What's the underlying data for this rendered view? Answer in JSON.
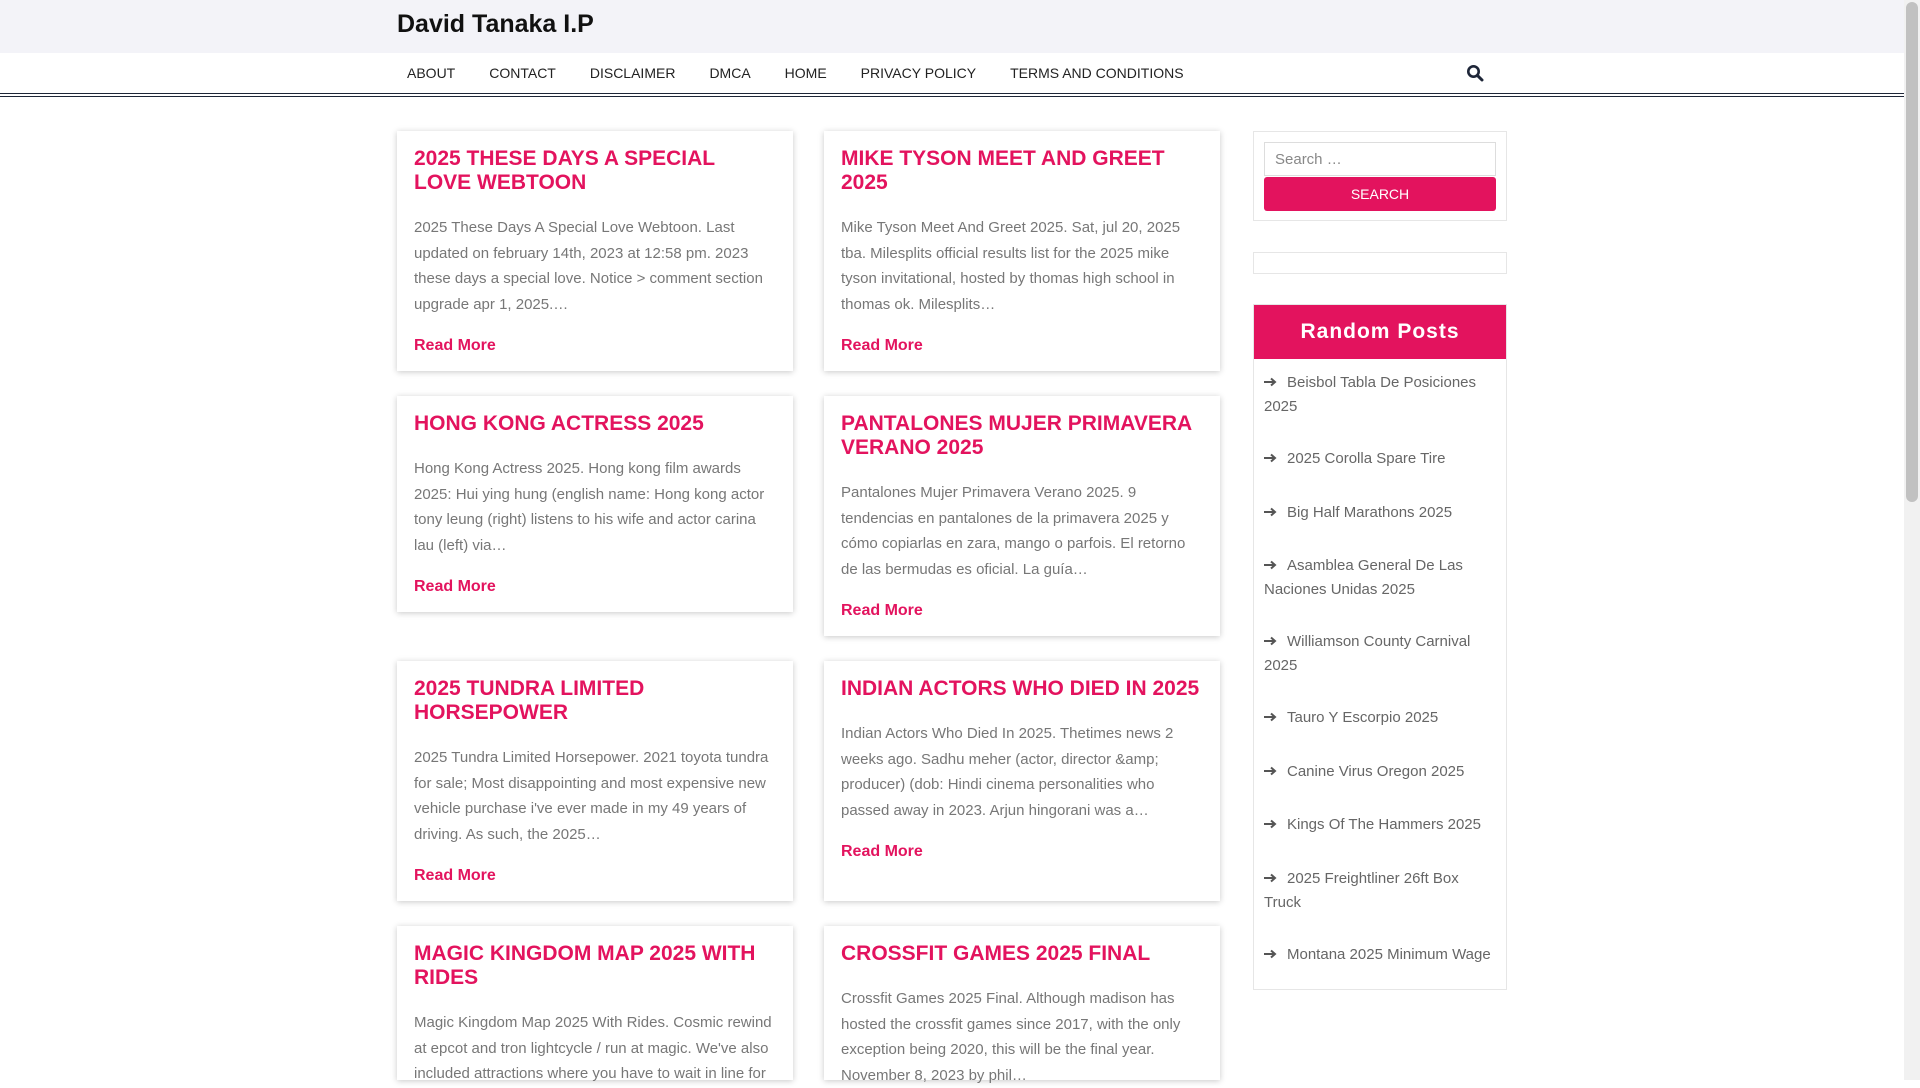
{
  "site": {
    "title": "David Tanaka I.P"
  },
  "nav": [
    "ABOUT",
    "CONTACT",
    "DISCLAIMER",
    "DMCA",
    "HOME",
    "PRIVACY POLICY",
    "TERMS AND CONDITIONS"
  ],
  "posts": [
    {
      "title": "2025 THESE DAYS A SPECIAL LOVE WEBTOON",
      "excerpt": "2025 These Days A Special Love Webtoon. Last updated on february 14th, 2023 at 12:58 pm. 2023 these days a special love. Notice > comment section upgrade apr 1, 2025.…",
      "more": "Read More"
    },
    {
      "title": "MIKE TYSON MEET AND GREET 2025",
      "excerpt": "Mike Tyson Meet And Greet 2025. Sat, jul 20, 2025 tba. Milesplits official results list for the 2025 mike tyson invitational, hosted by thomas high school in thomas ok. Milesplits…",
      "more": "Read More"
    },
    {
      "title": "HONG KONG ACTRESS 2025",
      "excerpt": "Hong Kong Actress 2025. Hong kong film awards 2025: Hui ying hung (english name: Hong kong actor tony leung (right) listens to his wife and actor carina lau (left) via…",
      "more": "Read More"
    },
    {
      "title": "PANTALONES MUJER PRIMAVERA VERANO 2025",
      "excerpt": "Pantalones Mujer Primavera Verano 2025. 9 tendencias en pantalones de la primavera 2025 y cómo copiarlas en zara, mango o parfois. El retorno de las bermudas es oficial. La guía…",
      "more": "Read More"
    },
    {
      "title": "2025 TUNDRA LIMITED HORSEPOWER",
      "excerpt": "2025 Tundra Limited Horsepower. 2021 toyota tundra for sale; Most disappointing and most expensive new vehicle purchase i've ever made in my 49 years of driving. As such, the 2025…",
      "more": "Read More"
    },
    {
      "title": "INDIAN ACTORS WHO DIED IN 2025",
      "excerpt": "Indian Actors Who Died In 2025. Thetimes news 2 weeks ago. Sadhu meher (actor, director &amp; producer) (dob: Hindi cinema personalities who passed away in 2023. Arjun hingorani was a…",
      "more": "Read More"
    },
    {
      "title": "MAGIC KINGDOM MAP 2025 WITH RIDES",
      "excerpt": "Magic Kingdom Map 2025 With Rides. Cosmic rewind at epcot and tron lightcycle / run at magic. We've also included attractions where you have to wait in line for",
      "more": ""
    },
    {
      "title": "CROSSFIT GAMES 2025 FINAL",
      "excerpt": "Crossfit Games 2025 Final. Although madison has hosted the crossfit games since 2017, with the only exception being 2020, this will be the final year. November 8, 2023 by phil…",
      "more": ""
    }
  ],
  "sidebar": {
    "search_placeholder": "Search …",
    "search_button": "SEARCH",
    "random_title": "Random Posts",
    "random_posts": [
      "Beisbol Tabla De Posiciones 2025",
      "2025 Corolla Spare Tire",
      "Big Half Marathons 2025",
      "Asamblea General De Las Naciones Unidas 2025",
      "Williamson County Carnival 2025",
      "Tauro Y Escorpio 2025",
      "Canine Virus Oregon 2025",
      "Kings Of The Hammers 2025",
      "2025 Freightliner 26ft Box Truck",
      "Montana 2025 Minimum Wage"
    ]
  },
  "colors": {
    "accent": "#e3135e",
    "nav_border": "#1e2638",
    "topbar": "#f3f3f8"
  },
  "icons": {
    "search": "search-icon",
    "list_bullet": "arrow-right-icon"
  }
}
